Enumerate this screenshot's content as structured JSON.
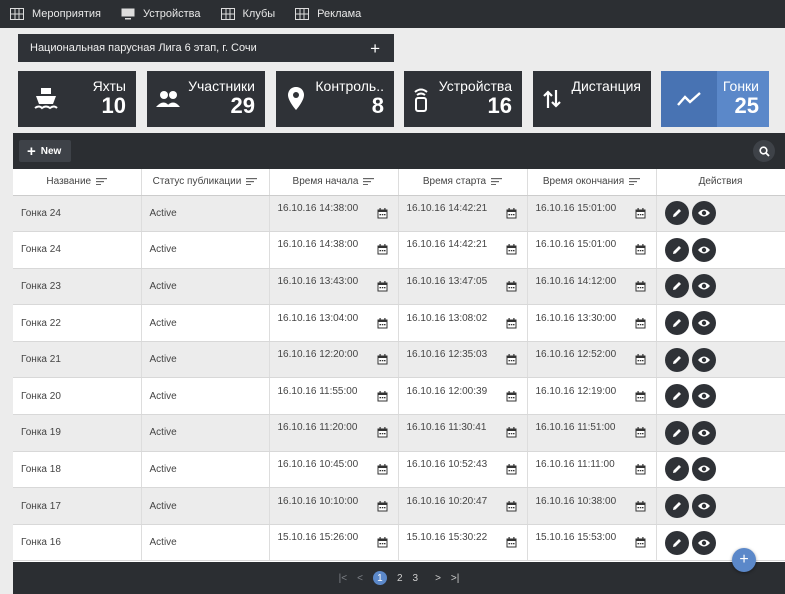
{
  "nav": [
    {
      "label": "Мероприятия",
      "icon": "grid-icon"
    },
    {
      "label": "Устройства",
      "icon": "monitor-icon"
    },
    {
      "label": "Клубы",
      "icon": "grid-icon"
    },
    {
      "label": "Реклама",
      "icon": "grid-icon"
    }
  ],
  "event": {
    "title": "Национальная парусная Лига 6 этап, г. Сочи",
    "add_label": "+"
  },
  "cards": [
    {
      "label": "Яхты",
      "count": "10",
      "icon": "ship-icon"
    },
    {
      "label": "Участники",
      "count": "29",
      "icon": "people-icon"
    },
    {
      "label": "Контроль..",
      "count": "8",
      "icon": "location-pin-icon"
    },
    {
      "label": "Устройства",
      "count": "16",
      "icon": "device-icon"
    },
    {
      "label": "Дистанция",
      "count": "",
      "icon": "swap-arrows-icon"
    },
    {
      "label": "Гонки",
      "count": "25",
      "icon": "trend-line-icon"
    }
  ],
  "toolbar": {
    "new_label": "New"
  },
  "table": {
    "headers": [
      "Название",
      "Статус публикации",
      "Время начала",
      "Время старта",
      "Время окончания",
      "Действия"
    ],
    "rows": [
      {
        "name": "Гонка 24",
        "status": "Active",
        "start": "16.10.16 14:38:00",
        "race_start": "16.10.16 14:42:21",
        "end": "16.10.16 15:01:00"
      },
      {
        "name": "Гонка 24",
        "status": "Active",
        "start": "16.10.16 14:38:00",
        "race_start": "16.10.16 14:42:21",
        "end": "16.10.16 15:01:00"
      },
      {
        "name": "Гонка 23",
        "status": "Active",
        "start": "16.10.16 13:43:00",
        "race_start": "16.10.16 13:47:05",
        "end": "16.10.16 14:12:00"
      },
      {
        "name": "Гонка 22",
        "status": "Active",
        "start": "16.10.16 13:04:00",
        "race_start": "16.10.16 13:08:02",
        "end": "16.10.16 13:30:00"
      },
      {
        "name": "Гонка 21",
        "status": "Active",
        "start": "16.10.16 12:20:00",
        "race_start": "16.10.16 12:35:03",
        "end": "16.10.16 12:52:00"
      },
      {
        "name": "Гонка 20",
        "status": "Active",
        "start": "16.10.16 11:55:00",
        "race_start": "16.10.16 12:00:39",
        "end": "16.10.16 12:19:00"
      },
      {
        "name": "Гонка 19",
        "status": "Active",
        "start": "16.10.16 11:20:00",
        "race_start": "16.10.16 11:30:41",
        "end": "16.10.16 11:51:00"
      },
      {
        "name": "Гонка 18",
        "status": "Active",
        "start": "16.10.16 10:45:00",
        "race_start": "16.10.16 10:52:43",
        "end": "16.10.16 11:11:00"
      },
      {
        "name": "Гонка 17",
        "status": "Active",
        "start": "16.10.16 10:10:00",
        "race_start": "16.10.16 10:20:47",
        "end": "16.10.16 10:38:00"
      },
      {
        "name": "Гонка 16",
        "status": "Active",
        "start": "15.10.16 15:26:00",
        "race_start": "15.10.16 15:30:22",
        "end": "15.10.16 15:53:00"
      }
    ]
  },
  "pagination": {
    "first": "|<",
    "prev": "<",
    "pages": [
      "1",
      "2",
      "3"
    ],
    "next": ">",
    "last": ">|"
  },
  "colors": {
    "dark": "#2f3237",
    "accent": "#5b88c9"
  }
}
